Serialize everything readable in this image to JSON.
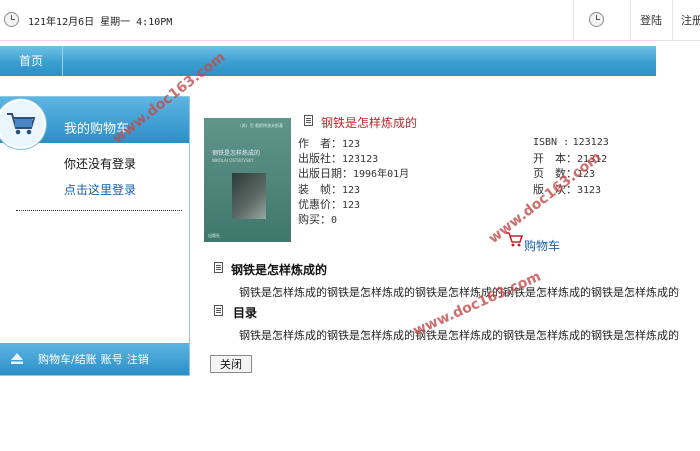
{
  "topbar": {
    "datetime": "121年12月6日 星期一 4:10PM",
    "login_label": "登陆",
    "register_label": "注册"
  },
  "nav": {
    "home_label": "首页",
    "colors": {
      "bar": "#3b9fd1",
      "text": "#ffffff"
    }
  },
  "sidebar": {
    "title": "我的购物车",
    "not_logged_in": "你还没有登录",
    "login_link": "点击这里登录",
    "footer": {
      "cart_checkout": "购物车/结账",
      "account": "账号",
      "logout": "注销"
    }
  },
  "book": {
    "title": "钢铁是怎样炼成的",
    "cover": {
      "author": "〔苏〕尼·奥斯特洛夫斯基",
      "title": "钢铁是怎样炼成的",
      "subtitle": "NIKOLAI OSTROVSKY",
      "publisher": "出版社"
    },
    "author": {
      "label": "作　者：",
      "value": "123"
    },
    "publisher": {
      "label": "出版社：",
      "value": "123123"
    },
    "publish_date": {
      "label": "出版日期：",
      "value": "1996年01月"
    },
    "binding": {
      "label": "装　帧：",
      "value": "123"
    },
    "sale_price": {
      "label": "优惠价：",
      "value": "123"
    },
    "purchased": {
      "label": "购买：",
      "value": "0"
    },
    "isbn": {
      "label": "ISBN :",
      "value": "123123"
    },
    "format": {
      "label": "开　本：",
      "value": "21312"
    },
    "pages": {
      "label": "页　数：",
      "value": "123"
    },
    "edition": {
      "label": "版　次：",
      "value": "3123"
    },
    "add_to_cart": "购物车",
    "title_color": "#c0262c"
  },
  "sections": {
    "intro_heading": "钢铁是怎样炼成的",
    "intro_body": "钢铁是怎样炼成的钢铁是怎样炼成的钢铁是怎样炼成的钢铁是怎样炼成的钢铁是怎样炼成的",
    "toc_heading": "目录",
    "toc_body": "钢铁是怎样炼成的钢铁是怎样炼成的钢铁是怎样炼成的钢铁是怎样炼成的钢铁是怎样炼成的"
  },
  "close_label": "关闭",
  "watermark": "www.doc163.com"
}
